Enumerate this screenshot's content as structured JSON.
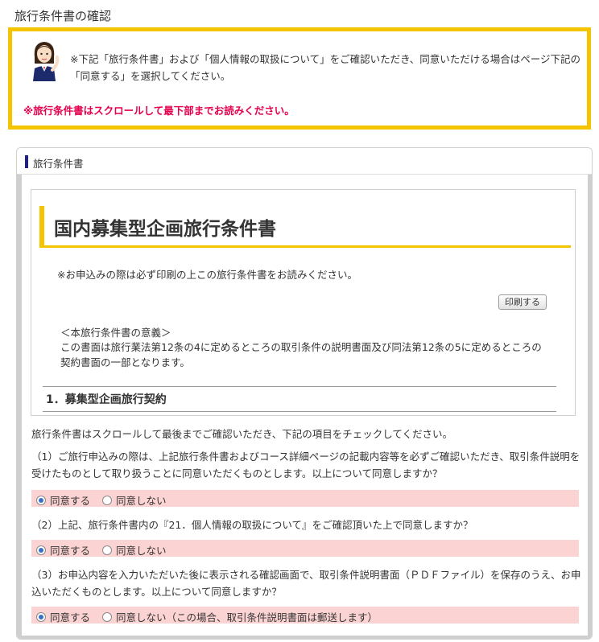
{
  "page": {
    "title": "旅行条件書の確認"
  },
  "notice": {
    "message": "※下記「旅行条件書」および「個人情報の取扱について」をご確認いただき、同意いただける場合はページ下記の「同意する」を選択してください。",
    "warning": "※旅行条件書はスクロールして最下部までお読みください。",
    "avatar_icon": "staff-woman-icon",
    "border_color": "#f5c400",
    "warning_color": "#e5004f"
  },
  "panel": {
    "header_label": "旅行条件書",
    "accent_color": "#1d2088"
  },
  "document": {
    "title": "国内募集型企画旅行条件書",
    "note": "※お申込みの際は必ず印刷の上この旅行条件書をお読みください。",
    "print_label": "印刷する",
    "purpose_title": "＜本旅行条件書の意義＞",
    "purpose_body": "この書面は旅行業法第12条の4に定めるところの取引条件の説明書面及び同法第12条の5に定めるところの契約書面の一部となります。",
    "section_title": "1．募集型企画旅行契約"
  },
  "consent": {
    "instruction": "旅行条件書はスクロールして最後までご確認いただき、下記の項目をチェックしてください。",
    "questions": [
      {
        "text": "（1）ご旅行申込みの際は、上記旅行条件書およびコース詳細ページの記載内容等を必ずご確認いただき、取引条件説明を受けたものとして取り扱うことに同意いただくものとします。以上について同意しますか？",
        "agree_label": "同意する",
        "disagree_label": "同意しない",
        "selected": "agree"
      },
      {
        "text": "（2）上記、旅行条件書内の『21．個人情報の取扱について』をご確認頂いた上で同意しますか？",
        "agree_label": "同意する",
        "disagree_label": "同意しない",
        "selected": "agree"
      },
      {
        "text": "（3）お申込内容を入力いただいた後に表示される確認画面で、取引条件説明書面（ＰＤＦファイル）を保存のうえ、お申込いただくものとします。以上について同意しますか？",
        "agree_label": "同意する",
        "disagree_label": "同意しない（この場合、取引条件説明書面は郵送します）",
        "selected": "agree"
      }
    ],
    "answer_bg_color": "#fcd3d3"
  }
}
